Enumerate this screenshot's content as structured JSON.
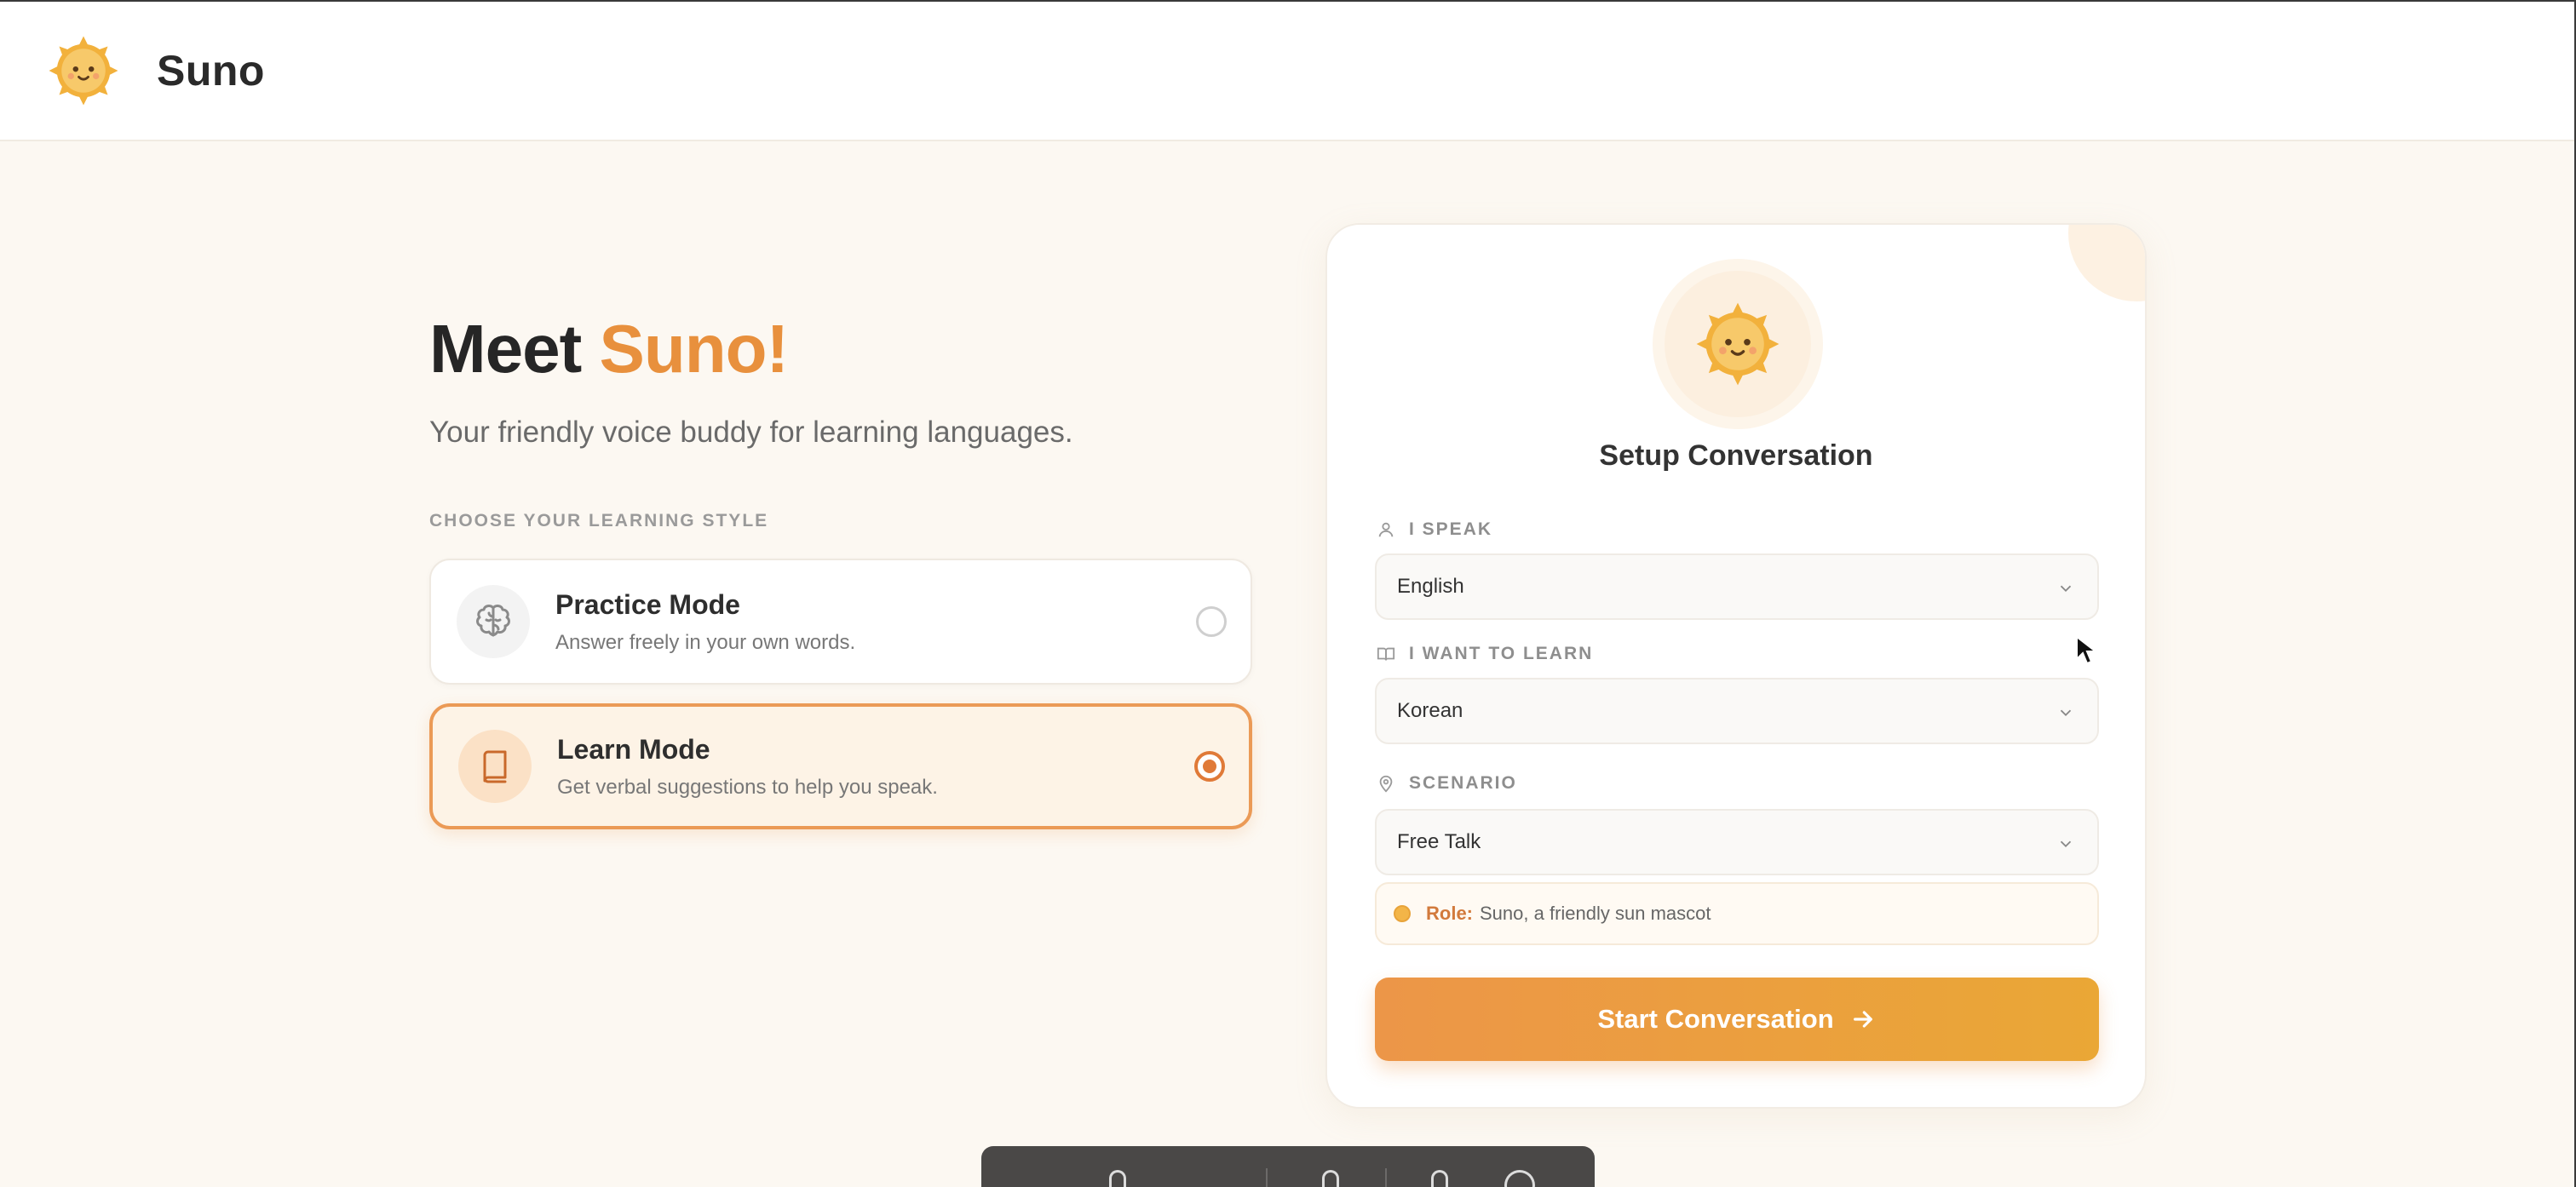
{
  "header": {
    "brand": "Suno",
    "logo_icon": "sun-mascot-icon"
  },
  "hero": {
    "title_prefix": "Meet ",
    "title_accent": "Suno!",
    "subtitle": "Your friendly voice buddy for learning languages."
  },
  "learning_style": {
    "label": "CHOOSE YOUR LEARNING STYLE",
    "modes": [
      {
        "title": "Practice Mode",
        "description": "Answer freely in your own words.",
        "icon": "brain-icon",
        "selected": false
      },
      {
        "title": "Learn Mode",
        "description": "Get verbal suggestions to help you speak.",
        "icon": "book-icon",
        "selected": true
      }
    ]
  },
  "setup": {
    "title": "Setup Conversation",
    "i_speak": {
      "label": "I SPEAK",
      "value": "English",
      "icon": "user-icon"
    },
    "i_want_to_learn": {
      "label": "I WANT TO LEARN",
      "value": "Korean",
      "icon": "open-book-icon"
    },
    "scenario": {
      "label": "SCENARIO",
      "value": "Free Talk",
      "icon": "map-pin-icon"
    },
    "role": {
      "key": "Role:",
      "value": "Suno, a friendly sun mascot"
    },
    "start_button": "Start Conversation"
  },
  "colors": {
    "accent": "#e8903d",
    "background": "#fcf8f2",
    "button_gradient_start": "#ec9648",
    "button_gradient_end": "#eaa736"
  }
}
